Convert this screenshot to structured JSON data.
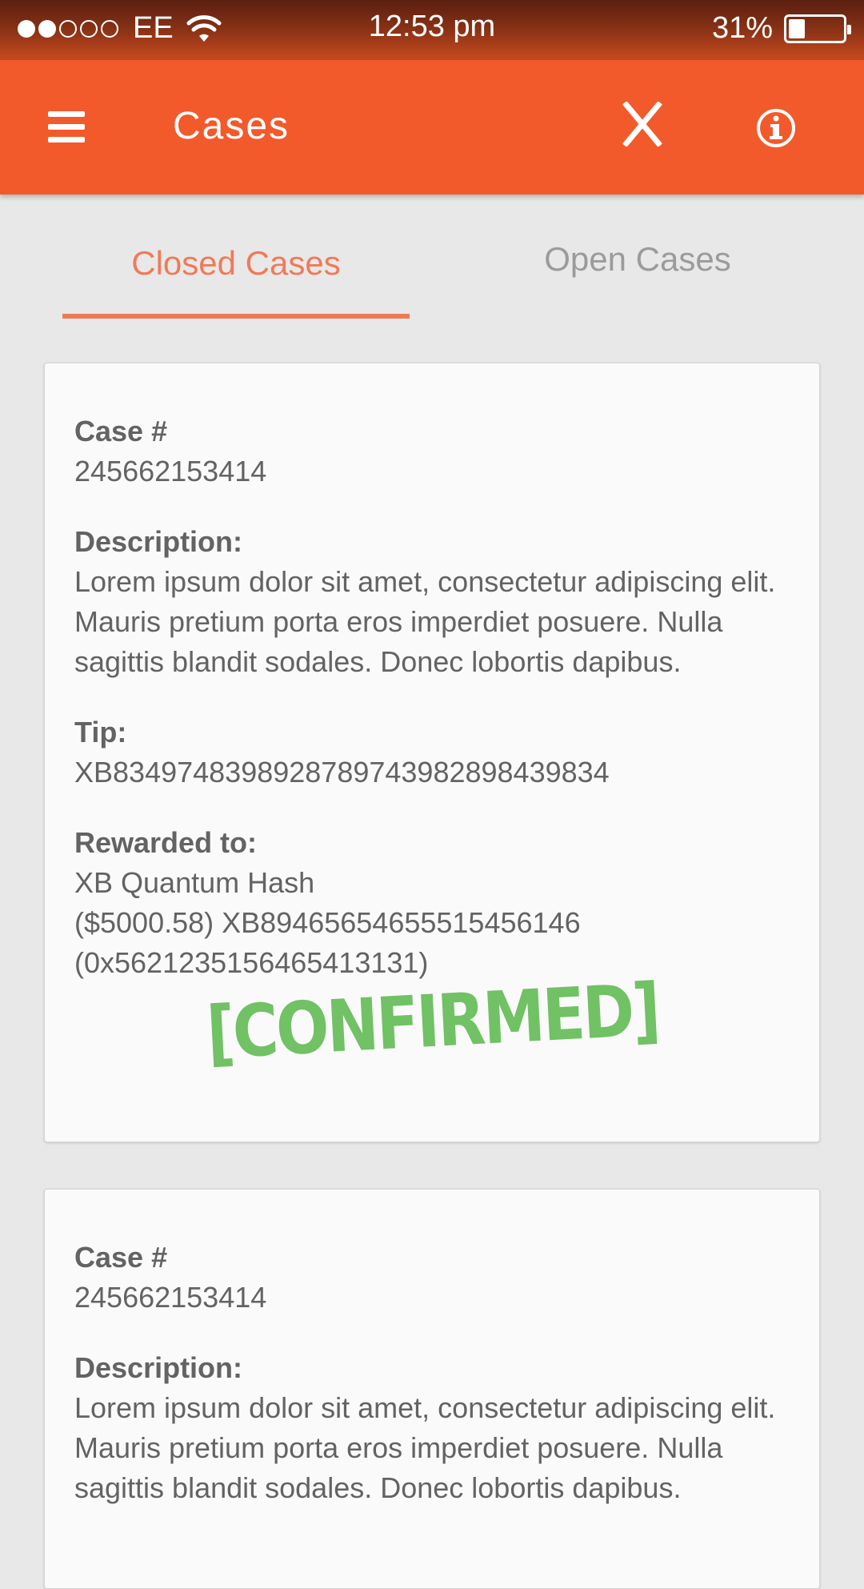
{
  "status_bar": {
    "carrier": "EE",
    "time": "12:53 pm",
    "battery_percent": "31%",
    "battery_level": 0.31,
    "signal_bars_filled": 2,
    "signal_bars_total": 5
  },
  "app_bar": {
    "title": "Cases",
    "close_label": "X",
    "menu_icon": "hamburger-menu-icon",
    "info_icon": "info-circle-icon",
    "background_color": "#f25a2b"
  },
  "tabs": [
    {
      "label": "Closed Cases",
      "active": true
    },
    {
      "label": "Open Cases",
      "active": false
    }
  ],
  "cases": [
    {
      "case_label": "Case #",
      "case_number": "245662153414",
      "description_label": "Description:",
      "description": "Lorem ipsum dolor sit amet, consectetur adipiscing elit. Mauris pretium porta eros imperdiet posuere. Nulla sagittis blandit sodales. Donec lobortis dapibus.",
      "tip_label": "Tip:",
      "tip": "XB834974839892878974398289843983 4",
      "rewarded_label": "Rewarded to:",
      "rewarded_lines": [
        "XB Quantum Hash",
        "($5000.58) XB89465654655515456146",
        "(0x5621235156465413131)"
      ],
      "status_stamp": "[CONFIRMED]"
    },
    {
      "case_label": "Case #",
      "case_number": "245662153414",
      "description_label": "Description:",
      "description": "Lorem ipsum dolor sit amet, consectetur adipiscing elit. Mauris pretium porta eros imperdiet posuere. Nulla sagittis blandit sodales. Donec lobortis dapibus."
    }
  ],
  "colors": {
    "accent": "#f25a2b",
    "tab_active": "#f07a58",
    "tab_inactive": "#9b9b9b",
    "stamp_green": "#6abf5e"
  }
}
